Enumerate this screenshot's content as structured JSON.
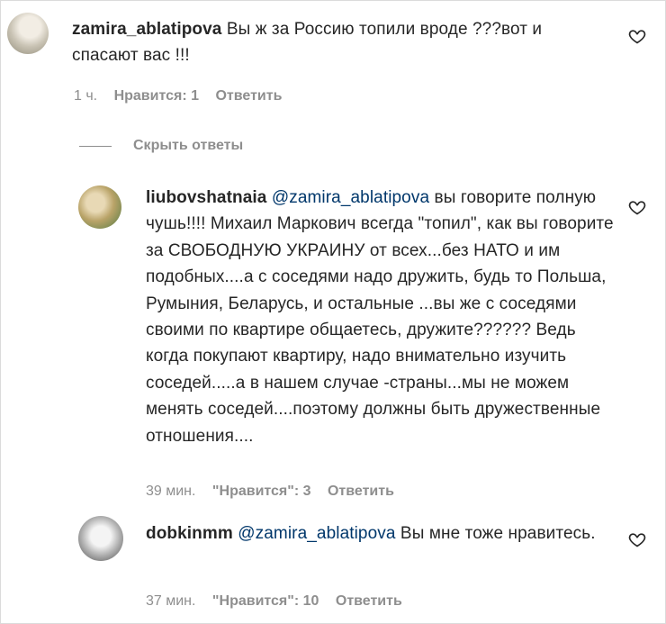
{
  "comments": [
    {
      "username": "zamira_ablatipova",
      "text": " Вы ж за Россию топили вроде ???вот и спасают вас !!!",
      "time": "1 ч.",
      "likes": "Нравится: 1",
      "reply": "Ответить"
    },
    {
      "username": "liubovshatnaia",
      "mention": "@zamira_ablatipova",
      "text": " вы говорите полную чушь!!!! Михаил Маркович всегда \"топил\", как вы говорите за СВОБОДНУЮ УКРАИНУ от всех...без НАТО и им подобных....а с соседями надо дружить, будь то Польша, Румыния, Беларусь, и остальные ...вы же с соседями своими по квартире общаетесь, дружите?????? Ведь когда покупают квартиру, надо внимательно изучить соседей.....а в нашем случае -страны...мы не можем менять соседей....поэтому должны быть дружественные отношения....",
      "time": "39 мин.",
      "likes": "\"Нравится\": 3",
      "reply": "Ответить"
    },
    {
      "username": "dobkinmm",
      "mention": "@zamira_ablatipova",
      "text": " Вы мне тоже нравитесь.",
      "time": "37 мин.",
      "likes": "\"Нравится\": 10",
      "reply": "Ответить"
    }
  ],
  "hide_replies": "Скрыть ответы",
  "icons": {
    "like": "heart-outline-icon"
  }
}
